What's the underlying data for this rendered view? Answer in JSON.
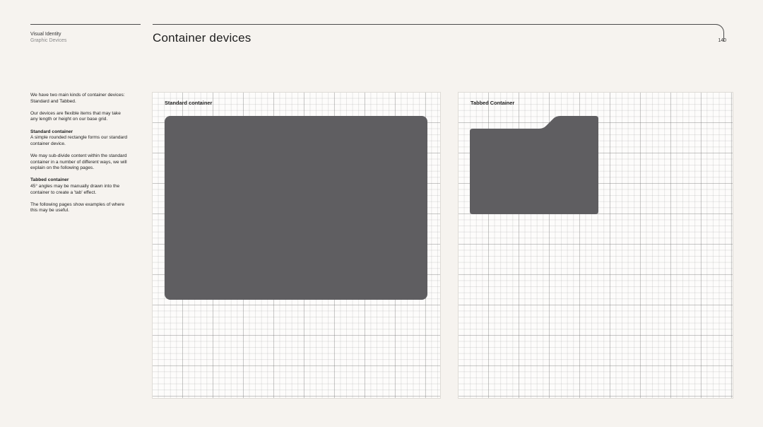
{
  "header": {
    "section_title": "Visual Identity",
    "section_subtitle": "Graphic Devices",
    "page_title": "Container devices",
    "page_number": "140"
  },
  "sidebar": {
    "intro_1": "We have two main kinds of container devices: Standard and Tabbed.",
    "intro_2": "Our devices are flexible items that may take any length or height on our base grid.",
    "standard_heading": "Standard container",
    "standard_text": "A simple rounded rectangle forms our standard container device.",
    "subdivide_text": "We may sub-divide content within the standard container in a number of different ways, we will explain on the following pages.",
    "tabbed_heading": "Tabbed container",
    "tabbed_text": "45° angles may be manually drawn into the container to create a 'tab' effect.",
    "examples_text": "The following pages show examples of where this may be useful."
  },
  "panels": {
    "standard_label": "Standard container",
    "tabbed_label": "Tabbed Container"
  },
  "colors": {
    "background": "#f6f3ef",
    "container_fill": "#5f5e61",
    "rule": "#4a4a4a"
  }
}
